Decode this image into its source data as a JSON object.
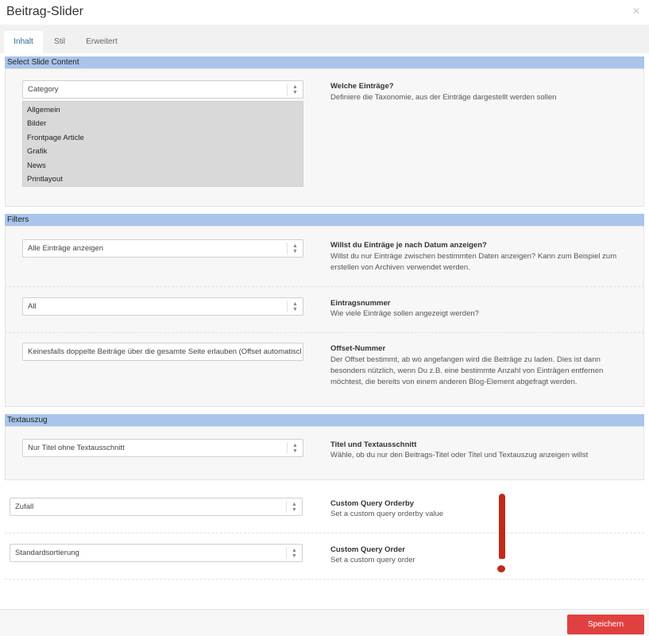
{
  "window": {
    "title": "Beitrag-Slider",
    "close_glyph": "✕"
  },
  "tabs": [
    {
      "label": "Inhalt",
      "active": true
    },
    {
      "label": "Stil",
      "active": false
    },
    {
      "label": "Erweitert",
      "active": false
    }
  ],
  "sections": {
    "slide_content": {
      "header": "Select Slide Content",
      "taxonomy_select": {
        "value": "Category"
      },
      "categories": [
        "Allgemein",
        "Bilder",
        "Frontpage Article",
        "Grafik",
        "News",
        "Printlayout"
      ],
      "label": "Welche Einträge?",
      "desc": "Definiere die Taxonomie, aus der Einträge dargestellt werden sollen"
    },
    "filters": {
      "header": "Filters",
      "date_filter": {
        "value": "Alle Einträge anzeigen",
        "label": "Willst du Einträge je nach Datum anzeigen?",
        "desc": "Willst du nur Einträge zwischen bestimmten Daten anzeigen? Kann zum Beispiel zum erstellen von Archiven verwendet werden."
      },
      "entry_count": {
        "value": "All",
        "label": "Eintragsnummer",
        "desc": "Wie viele Einträge sollen angezeigt werden?"
      },
      "offset": {
        "value": "Keinesfalls doppelte Beiträge über die gesamte Seite erlauben (Offset automatisch",
        "label": "Offset-Nummer",
        "desc": "Der Offset bestimmt, ab wo angefangen wird die Beiträge zu laden. Dies ist dann besonders nützlich, wenn Du z.B. eine bestimmte Anzahl von Einträgen entfernen möchtest, die bereits von einem anderen Blog-Element abgefragt werden."
      }
    },
    "excerpt": {
      "header": "Textauszug",
      "mode": {
        "value": "Nur Titel ohne Textausschnitt",
        "label": "Titel und Textausschnitt",
        "desc": "Wähle, ob du nur den Beitrags-Titel oder Titel und Textauszug anzeigen willst"
      }
    },
    "query": {
      "orderby": {
        "value": "Zufall",
        "label": "Custom Query Orderby",
        "desc": "Set a custom query orderby value"
      },
      "order": {
        "value": "Standardsortierung",
        "label": "Custom Query Order",
        "desc": "Set a custom query order"
      }
    }
  },
  "footer": {
    "save_label": "Speichern"
  },
  "icons": {
    "select_arrows": "up-down-arrows-icon",
    "annotation": "exclamation-mark-icon"
  },
  "colors": {
    "section_header": "#a9c5ea",
    "save_button": "#e04040",
    "active_tab": "#2a6a9a",
    "annotation": "#c22a1a"
  }
}
